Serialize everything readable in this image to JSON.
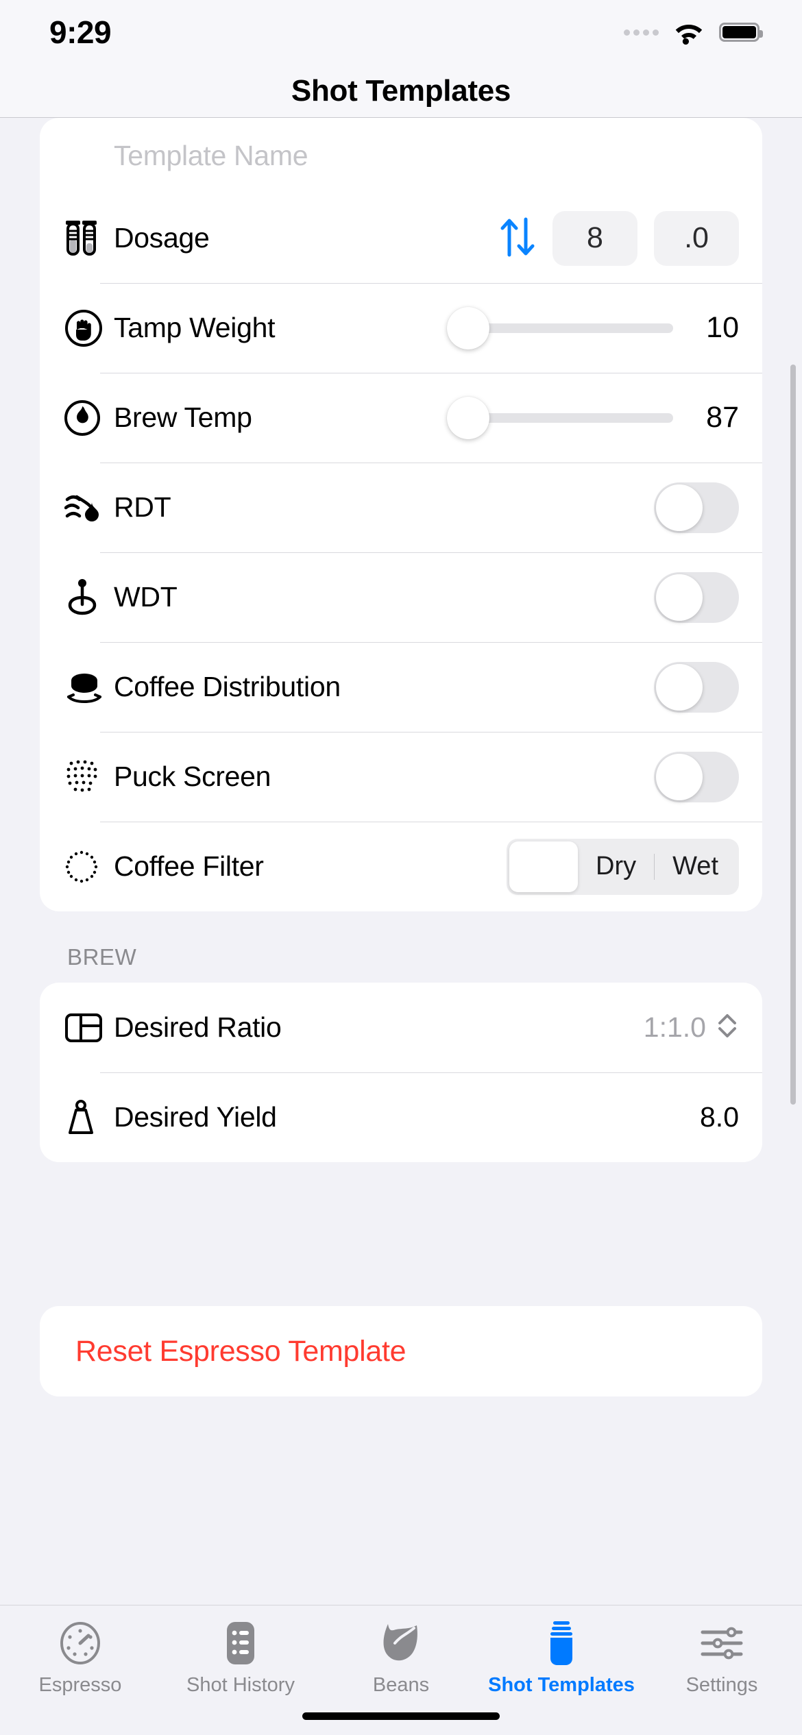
{
  "status_bar": {
    "time": "9:29",
    "signal_icon": "signal-dots-icon",
    "wifi_icon": "wifi-icon",
    "battery_icon": "battery-full-icon"
  },
  "nav": {
    "title": "Shot Templates"
  },
  "template_name": {
    "placeholder": "Template Name",
    "value": ""
  },
  "prep_section": {
    "rows": [
      {
        "key": "dosage",
        "icon": "testtubes-icon",
        "label": "Dosage",
        "control": "stepper",
        "arrows_icon": "arrow-up-arrow-down-icon",
        "whole": "8",
        "decimal": ".0"
      },
      {
        "key": "tamp_weight",
        "icon": "hand-tamp-icon",
        "label": "Tamp Weight",
        "control": "slider",
        "value": "10",
        "fill_percent": 0
      },
      {
        "key": "brew_temp",
        "icon": "flame-drop-icon",
        "label": "Brew Temp",
        "control": "slider",
        "value": "87",
        "fill_percent": 0
      },
      {
        "key": "rdt",
        "icon": "water-spray-icon",
        "label": "RDT",
        "control": "toggle",
        "on": false
      },
      {
        "key": "wdt",
        "icon": "wdt-needle-icon",
        "label": "WDT",
        "control": "toggle",
        "on": false
      },
      {
        "key": "coffee_distribution",
        "icon": "distributor-icon",
        "label": "Coffee Distribution",
        "control": "toggle",
        "on": false
      },
      {
        "key": "puck_screen",
        "icon": "dotted-mesh-icon",
        "label": "Puck Screen",
        "control": "toggle",
        "on": false
      },
      {
        "key": "coffee_filter",
        "icon": "dotted-circle-icon",
        "label": "Coffee Filter",
        "control": "segmented",
        "segments": [
          "",
          "Dry",
          "Wet"
        ],
        "selected_index": 0
      }
    ]
  },
  "brew_section": {
    "header": "BREW",
    "rows": [
      {
        "key": "desired_ratio",
        "icon": "ratio-box-icon",
        "label": "Desired Ratio",
        "value": "1:1.0",
        "accessory_icon": "chevron-up-down-icon",
        "muted": true
      },
      {
        "key": "desired_yield",
        "icon": "scale-weight-icon",
        "label": "Desired Yield",
        "value": "8.0",
        "muted": false
      }
    ]
  },
  "reset": {
    "label": "Reset Espresso Template"
  },
  "tabbar": {
    "items": [
      {
        "icon": "gauge-icon",
        "label": "Espresso",
        "active": false
      },
      {
        "icon": "list-bullet-icon",
        "label": "Shot History",
        "active": false
      },
      {
        "icon": "leaf-icon",
        "label": "Beans",
        "active": false
      },
      {
        "icon": "jar-icon",
        "label": "Shot Templates",
        "active": true
      },
      {
        "icon": "sliders-icon",
        "label": "Settings",
        "active": false
      }
    ]
  },
  "colors": {
    "accent": "#007AFF",
    "destructive": "#FF3B30",
    "background": "#F2F2F7",
    "card": "#FFFFFF",
    "secondary_text": "#8A8A8E"
  }
}
